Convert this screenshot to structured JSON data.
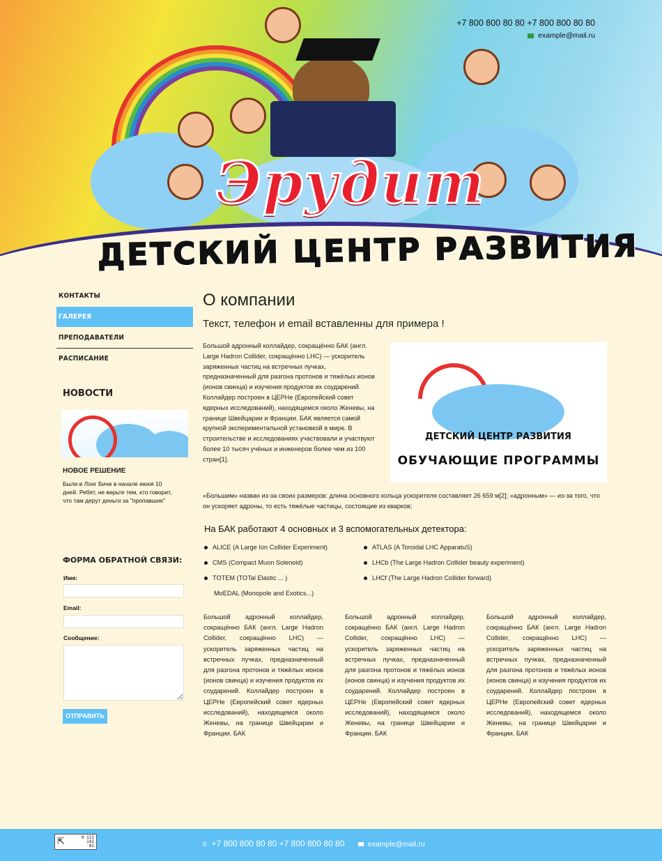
{
  "header": {
    "phones": "+7 800 800 80 80  +7 800 800 80 80",
    "email": "example@mail.ru",
    "logo_text": "Эрудит",
    "subtitle": "ДЕТСКИЙ ЦЕНТР РАЗВИТИЯ"
  },
  "sidebar": {
    "menu": [
      {
        "label": "КОНТАКТЫ"
      },
      {
        "label": "ГАЛЕРЕЯ"
      },
      {
        "label": "ПРЕПОДАВАТЕЛИ"
      },
      {
        "label": "РАСПИСАНИЕ"
      }
    ],
    "active_index": 1,
    "news_heading": "НОВОСТИ",
    "news_item_title": "НОВОЕ РЕШЕНИЕ",
    "news_item_text": "Были в Лонг Биче в начале июня 10 дней. Ребят, не верьте тем, кто говорит, что там дерут деньги за \"пропавшие\"",
    "feedback_heading": "ФОРМА ОБРАТНОЙ СВЯЗИ:",
    "name_label": "Имя:",
    "email_label": "Email:",
    "message_label": "Сообщение:",
    "submit_label": "ОТПРАВИТЬ"
  },
  "main": {
    "title": "О компании",
    "subtitle": "Текст, телефон и email вставленны для примера !",
    "intro": "Большой адронный коллайдер, сокращённо БАК (англ. Large Hadron Collider, сокращённо LHC) — ускоритель заряженных частиц на встречных пучках, предназначенный для разгона протонов и тяжёлых ионов (ионов свинца) и изучения продуктов их соударений. Коллайдер построен в ЦЕРНе (Европейский совет ядерных исследований), находящемся около Женевы, на границе Швейцарии и Франции. БАК является самой крупной экспериментальной установкой в мире. В строительстве и исследованиях участвовали и участвуют более 10 тысяч учёных и инженеров более чем из 100 стран[1].",
    "image_caption_top": "ДЕТСКИЙ ЦЕНТР РАЗВИТИЯ",
    "image_caption_bottom": "ОБУЧАЮЩИЕ ПРОГРАММЫ",
    "paragraph2": "«Большим» назван из-за своих размеров: длина основного кольца ускорителя составляет 26 659 м[2]; «адронным» — из-за того, что он ускоряет адроны, то есть тяжёлые частицы, состоящие из кварков;",
    "detectors_heading": "На БАК работают 4 основных и 3 вспомогательных детектора:",
    "detectors_left": [
      "ALICE (A Large Ion Collider Experiment)",
      "CMS (Compact Muon Solenoid)",
      "TOTEM (TOTal Elastic ... )"
    ],
    "detectors_left_extra": "MoEDAL (Monopole and Exotics...)",
    "detectors_right": [
      "ATLAS (A Toroidal LHC ApparatuS)",
      "LHCb (The Large Hadron Collider beauty experiment)",
      "LHCf (The Large Hadron Collider forward)"
    ],
    "columns": [
      "Большой адронный коллайдер, сокращённо БАК (англ. Large Hadron Collider, сокращённо LHC) — ускоритель заряженных частиц на встречных пучках, предназначенный для разгона протонов и тяжёлых ионов (ионов свинца) и изучения продуктов их соударений. Коллайдер построен в ЦЕРНе (Европейский совет ядерных исследований), находящемся около Женевы, на границе Швейцарии и Франции. БАК",
      "Большой адронный коллайдер, сокращённо БАК (англ. Large Hadron Collider, сокращённо LHC) — ускоритель заряженных частиц на встречных пучках, предназначенный для разгона протонов и тяжёлых ионов (ионов свинца) и изучения продуктов их соударений. Коллайдер построен в ЦЕРНе (Европейский совет ядерных исследований), находящемся около Женевы, на границе Швейцарии и Франции. БАК",
      "Большой адронный коллайдер, сокращённо БАК (англ. Large Hadron Collider, сокращённо LHC) — ускоритель заряженных частиц на встречных пучках, предназначенный для разгона протонов и тяжёлых ионов (ионов свинца) и изучения продуктов их соударений. Коллайдер построен в ЦЕРНе (Европейский совет ядерных исследований), находящемся около Женевы, на границе Швейцарии и Франции. БАК"
    ]
  },
  "footer": {
    "phones": "+7 800 800 80 80  +7 800 800 80 80",
    "email": "example@mail.ru",
    "counter_lines": [
      "0 121",
      "141",
      "81"
    ]
  },
  "colors": {
    "accent": "#5fc0f5",
    "page_bg": "#fdf6dc",
    "logo_red": "#e8202e"
  }
}
